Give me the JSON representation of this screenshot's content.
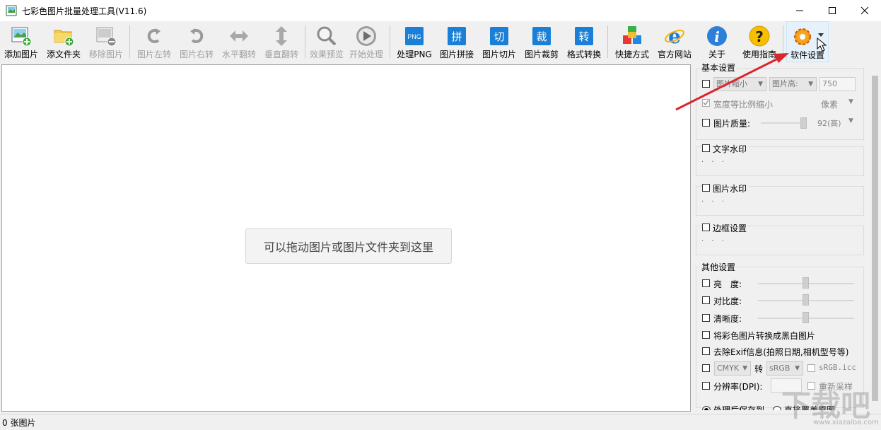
{
  "window": {
    "title": "七彩色图片批量处理工具(V11.6)"
  },
  "toolbar": {
    "add_image": "添加图片",
    "add_folder": "添文件夹",
    "remove_image": "移除图片",
    "rotate_left": "图片左转",
    "rotate_right": "图片右转",
    "flip_h": "水平翻转",
    "flip_v": "垂直翻转",
    "preview": "效果预览",
    "start": "开始处理",
    "png": "处理PNG",
    "png_icon_text": "PNG",
    "stitch": "图片拼接",
    "stitch_icon_text": "拼",
    "slice": "图片切片",
    "slice_icon_text": "切",
    "crop": "图片裁剪",
    "crop_icon_text": "裁",
    "convert": "格式转换",
    "convert_icon_text": "转",
    "shortcut": "快捷方式",
    "website": "官方网站",
    "about": "关于",
    "guide": "使用指南",
    "settings": "软件设置"
  },
  "canvas": {
    "drop_hint": "可以拖动图片或图片文件夹到这里"
  },
  "panel": {
    "basic_title": "基本设置",
    "resize_select": "图片缩小",
    "height_select": "图片高:",
    "height_value": "750",
    "keep_ratio": "宽度等比例缩小",
    "unit_select": "像素",
    "quality_label": "图片质量:",
    "quality_value": "92(高)",
    "text_watermark": "文字水印",
    "image_watermark": "图片水印",
    "border_settings": "边框设置",
    "dots": "· · ·",
    "other_title": "其他设置",
    "brightness": "亮　度:",
    "contrast": "对比度:",
    "sharpness": "清晰度:",
    "to_bw": "将彩色图片转换成黑白图片",
    "remove_exif": "去除Exif信息(拍照日期,相机型号等)",
    "cmyk_select": "CMYK",
    "to_label": "转",
    "srgb_select": "sRGB",
    "srgb_icc": "sRGB.icc",
    "dpi_label": "分辨率(DPI):",
    "resample": "重新采样",
    "save_after": "处理后保存到",
    "overwrite": "直接覆盖原图"
  },
  "status": {
    "count": "0 张图片"
  },
  "watermark": {
    "main": "下载吧",
    "url": "www.xiazaiba.com"
  },
  "colors": {
    "accent": "#1a7fd6",
    "arrow": "#d9262c"
  }
}
